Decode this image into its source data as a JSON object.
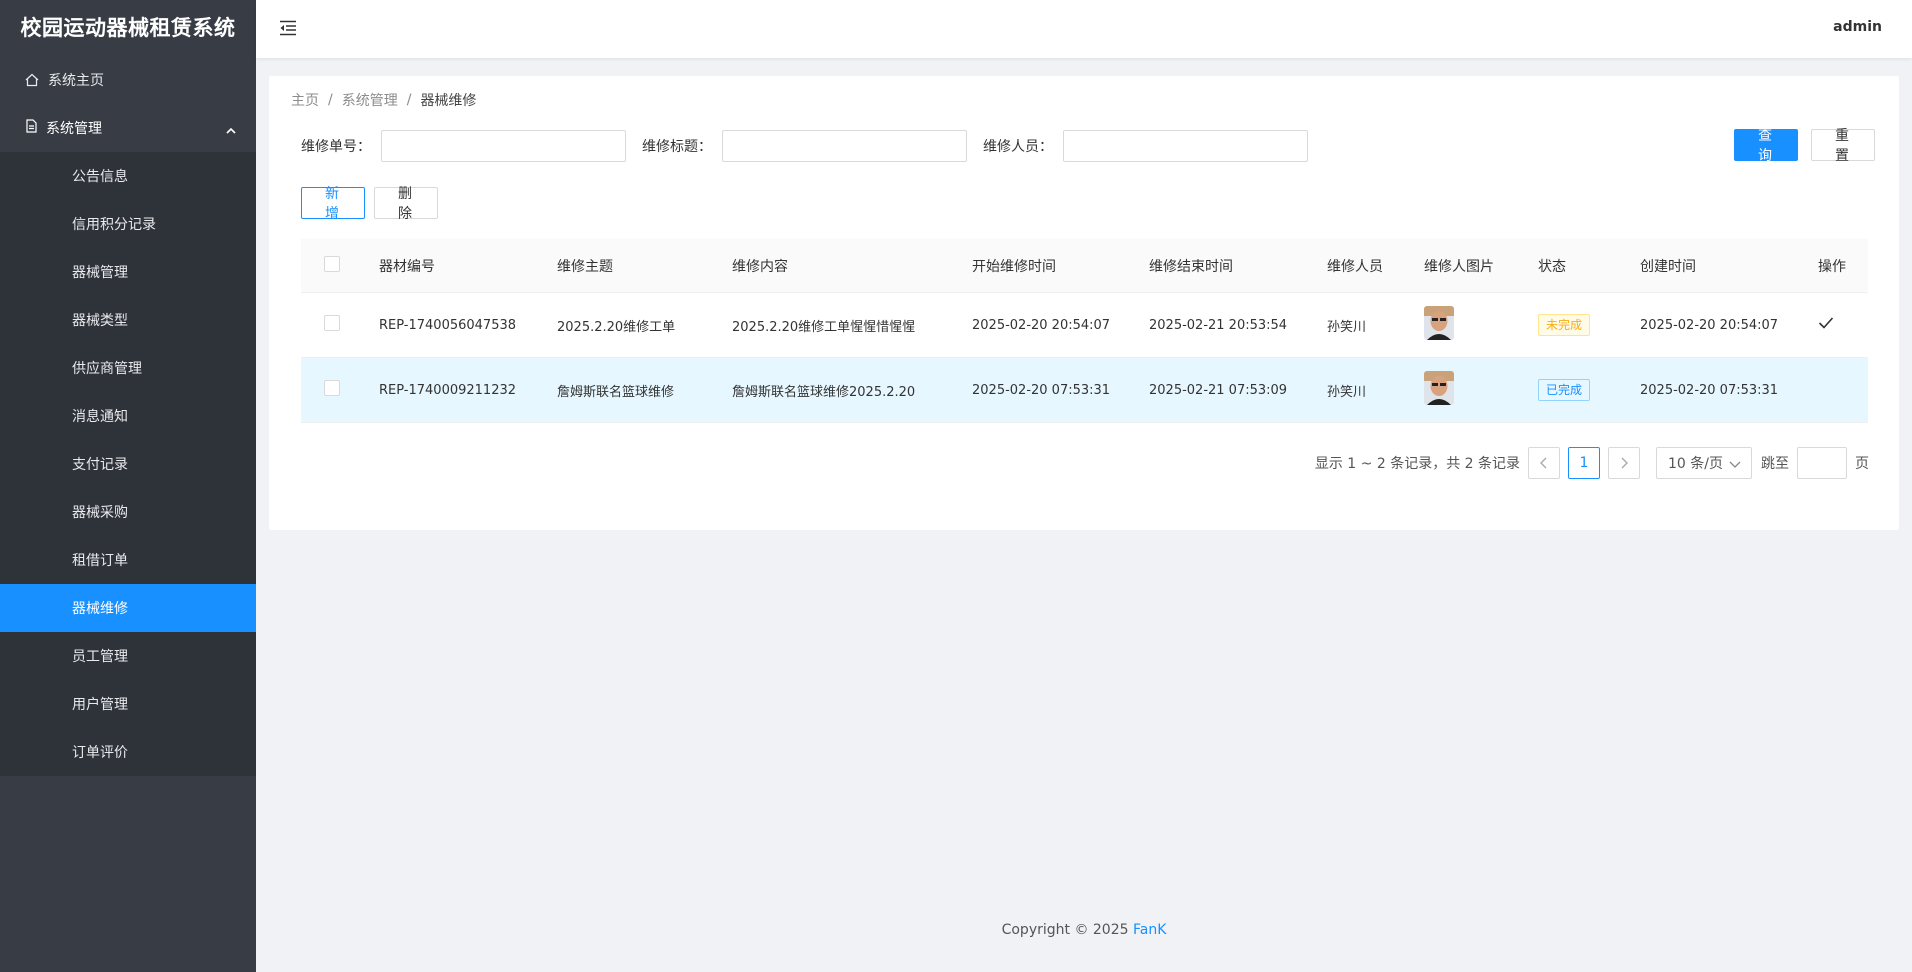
{
  "sidebar": {
    "brand": "校园运动器械租赁系统",
    "home": {
      "label": "系统主页",
      "icon": "home-icon"
    },
    "group": {
      "label": "系统管理",
      "icon": "file-icon"
    },
    "items": [
      {
        "label": "公告信息"
      },
      {
        "label": "信用积分记录"
      },
      {
        "label": "器械管理"
      },
      {
        "label": "器械类型"
      },
      {
        "label": "供应商管理"
      },
      {
        "label": "消息通知"
      },
      {
        "label": "支付记录"
      },
      {
        "label": "器械采购"
      },
      {
        "label": "租借订单"
      },
      {
        "label": "器械维修",
        "active": true
      },
      {
        "label": "员工管理"
      },
      {
        "label": "用户管理"
      },
      {
        "label": "订单评价"
      }
    ]
  },
  "header": {
    "user": "admin"
  },
  "breadcrumb": {
    "home": "主页",
    "parent": "系统管理",
    "current": "器械维修",
    "separator": "/"
  },
  "search": {
    "fields": [
      {
        "label": "维修单号：",
        "value": ""
      },
      {
        "label": "维修标题：",
        "value": ""
      },
      {
        "label": "维修人员：",
        "value": ""
      }
    ],
    "query_label": "查 询",
    "reset_label": "重 置"
  },
  "actions": {
    "add_label": "新 增",
    "delete_label": "删 除"
  },
  "table": {
    "headers": [
      "器材编号",
      "维修主题",
      "维修内容",
      "开始维修时间",
      "维修结束时间",
      "维修人员",
      "维修人图片",
      "状态",
      "创建时间",
      "操作"
    ],
    "rows": [
      {
        "code": "REP-1740056047538",
        "subject": "2025.2.20维修工单",
        "content": "2025.2.20维修工单惺惺惜惺惺",
        "start": "2025-02-20 20:54:07",
        "end": "2025-02-21 20:53:54",
        "staff": "孙笑川",
        "status": "未完成",
        "created": "2025-02-20 20:54:07",
        "action_icon": "check-icon"
      },
      {
        "code": "REP-1740009211232",
        "subject": "詹姆斯联名篮球维修",
        "content": "詹姆斯联名篮球维修2025.2.20",
        "start": "2025-02-20 07:53:31",
        "end": "2025-02-21 07:53:09",
        "staff": "孙笑川",
        "status": "已完成",
        "created": "2025-02-20 07:53:31"
      }
    ]
  },
  "pagination": {
    "total_text": "显示 1 ~ 2 条记录，共 2 条记录",
    "current_page": "1",
    "page_size": "10 条/页",
    "jump_label": "跳至",
    "page_unit": "页"
  },
  "footer": {
    "copyright": "Copyright © 2025",
    "author": "FanK"
  },
  "colors": {
    "sidebar": "#383d45",
    "submenu": "#2e3239",
    "primary": "#1890ff",
    "warning": "#faad14"
  }
}
